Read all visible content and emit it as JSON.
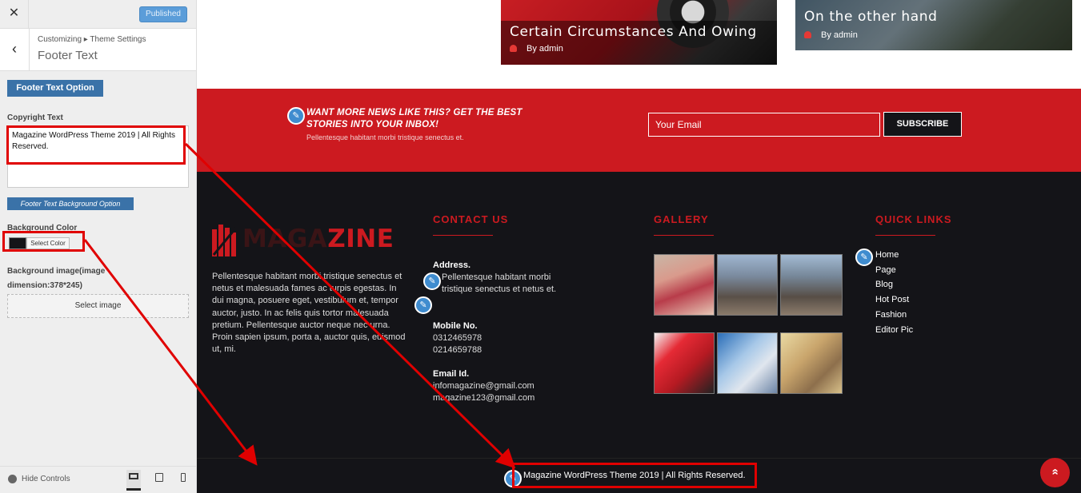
{
  "customizer": {
    "close_icon": "✕",
    "published_label": "Published",
    "breadcrumb": "Customizing ▸ Theme Settings",
    "section_title": "Footer Text",
    "back_icon": "‹",
    "footer_text_option_label": "Footer Text Option",
    "copyright_label": "Copyright Text",
    "copyright_value": "Magazine WordPress Theme 2019 | All Rights Reserved.",
    "bg_option_label": "Footer Text Background Option",
    "bg_color_label": "Background Color",
    "bg_color_value": "#141418",
    "select_color_label": "Select Color",
    "bg_image_label": "Background image(image dimension:378*245)",
    "select_image_label": "Select image",
    "hide_controls_label": "Hide Controls"
  },
  "posts": [
    {
      "title": "Certain Circumstances And Owing",
      "author": "By admin"
    },
    {
      "title": "On the other hand",
      "author": "By admin"
    }
  ],
  "newsletter": {
    "heading": "WANT MORE NEWS LIKE THIS? GET THE BEST STORIES INTO YOUR INBOX!",
    "subtext": "Pellentesque habitant morbi tristique senectus et.",
    "email_placeholder": "Your Email",
    "subscribe_label": "SUBSCRIBE"
  },
  "footer": {
    "logo_text_dim": "MAGA",
    "logo_text_red": "ZINE",
    "about": "Pellentesque habitant morbi tristique senectus et netus et malesuada fames ac turpis egestas. In dui magna, posuere eget, vestibulum et, tempor auctor, justo. In ac felis quis tortor malesuada pretium. Pellentesque auctor neque nec urna. Proin sapien ipsum, porta a, auctor quis, euismod ut, mi.",
    "contact": {
      "heading": "CONTACT US",
      "address_label": "Address.",
      "address": "Pellentesque habitant morbi tristique senectus et netus et.",
      "mobile_label": "Mobile No.",
      "mobile_1": "0312465978",
      "mobile_2": "0214659788",
      "email_label": "Email Id.",
      "email_1": "infomagazine@gmail.com",
      "email_2": "magazine123@gmail.com"
    },
    "gallery": {
      "heading": "GALLERY"
    },
    "quick_links": {
      "heading": "QUICK LINKS",
      "items": [
        "Home",
        "Page",
        "Blog",
        "Hot Post",
        "Fashion",
        "Editor Pic"
      ]
    },
    "copyright": "Magazine WordPress Theme 2019 | All Rights Reserved.",
    "scroll_top_icon": "»"
  },
  "colors": {
    "brand_red": "#cc1a20",
    "footer_dark": "#141418",
    "customizer_blue": "#3a72a8",
    "annotation_red": "#e00000"
  }
}
